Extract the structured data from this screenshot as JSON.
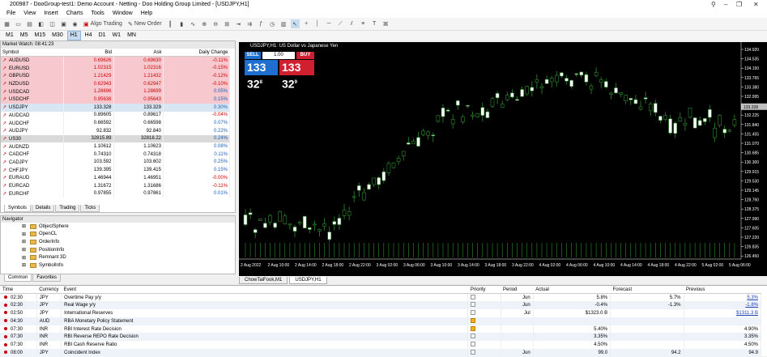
{
  "window": {
    "title": "200987 - DooGroup-test1: Demo Account - Netting - Doo Holding Group Limited - [USDJPY,H1]"
  },
  "menu": [
    "File",
    "View",
    "Insert",
    "Charts",
    "Tools",
    "Window",
    "Help"
  ],
  "toolbar": {
    "algo_label": "Algo Trading",
    "neworder_label": "New Order"
  },
  "timeframes": [
    "M1",
    "M5",
    "M15",
    "M30",
    "H1",
    "H4",
    "D1",
    "W1",
    "MN"
  ],
  "market_watch": {
    "title": "Market Watch: 08:41:23",
    "headers": [
      "Symbol",
      "Bid",
      "Ask",
      "Daily Change"
    ],
    "rows": [
      {
        "s": "AUDUSD",
        "b": "0.69626",
        "a": "0.69630",
        "c": "-0.11%",
        "t": "red"
      },
      {
        "s": "EURUSD",
        "b": "1.02315",
        "a": "1.02316",
        "c": "-0.15%",
        "t": "red"
      },
      {
        "s": "GBPUSD",
        "b": "1.21429",
        "a": "1.21432",
        "c": "-0.12%",
        "t": "red"
      },
      {
        "s": "NZDUSD",
        "b": "0.62943",
        "a": "0.62947",
        "c": "-0.10%",
        "t": "red"
      },
      {
        "s": "USDCAD",
        "b": "1.28696",
        "a": "1.28699",
        "c": "0.05%",
        "t": "red"
      },
      {
        "s": "USDCHF",
        "b": "0.95638",
        "a": "0.95643",
        "c": "0.15%",
        "t": "red"
      },
      {
        "s": "USDJPY",
        "b": "133.328",
        "a": "133.329",
        "c": "0.30%",
        "t": "sel"
      },
      {
        "s": "AUDCAD",
        "b": "0.89605",
        "a": "0.89617",
        "c": "-0.04%",
        "t": ""
      },
      {
        "s": "AUDCHF",
        "b": "0.66592",
        "a": "0.66598",
        "c": "0.07%",
        "t": ""
      },
      {
        "s": "AUDJPY",
        "b": "92.832",
        "a": "92.840",
        "c": "0.22%",
        "t": ""
      },
      {
        "s": "US30",
        "b": "32815.89",
        "a": "32818.22",
        "c": "0.24%",
        "t": "gray"
      },
      {
        "s": "AUDNZD",
        "b": "1.10612",
        "a": "1.10623",
        "c": "0.08%",
        "t": ""
      },
      {
        "s": "CADCHF",
        "b": "0.74310",
        "a": "0.74318",
        "c": "0.11%",
        "t": ""
      },
      {
        "s": "CADJPY",
        "b": "103.592",
        "a": "103.602",
        "c": "0.25%",
        "t": ""
      },
      {
        "s": "CHFJPY",
        "b": "139.395",
        "a": "139.415",
        "c": "0.15%",
        "t": ""
      },
      {
        "s": "EURAUD",
        "b": "1.46944",
        "a": "1.46951",
        "c": "-0.00%",
        "t": ""
      },
      {
        "s": "EURCAD",
        "b": "1.31672",
        "a": "1.31686",
        "c": "-0.11%",
        "t": ""
      },
      {
        "s": "EURCHF",
        "b": "0.97855",
        "a": "0.97861",
        "c": "0.01%",
        "t": ""
      }
    ],
    "tabs": [
      "Symbols",
      "Details",
      "Trading",
      "Ticks"
    ]
  },
  "navigator": {
    "title": "Navigator",
    "items": [
      "ObjectSphere",
      "OpenCL",
      "OrderInfo",
      "PositionInfo",
      "Remnant 3D",
      "SymbolInfo"
    ],
    "tabs": [
      "Common",
      "Favorites"
    ]
  },
  "chart": {
    "title": "USDJPY,H1:  US Dollar vs Japanese Yen",
    "sell_label": "SELL",
    "buy_label": "BUY",
    "lot": "1.00",
    "sell_big": "133 32",
    "sell_sup": "8",
    "buy_big": "133 32",
    "buy_sup": "9",
    "price_labels": [
      "134.920",
      "134.535",
      "134.150",
      "133.765",
      "133.380",
      "132.995",
      "132.610",
      "132.225",
      "131.840",
      "131.455",
      "131.070",
      "130.685",
      "130.300",
      "129.915",
      "129.530",
      "129.145",
      "128.760",
      "128.375",
      "127.990",
      "127.605",
      "127.220",
      "126.835",
      "126.450"
    ],
    "current_price": "133.328",
    "time_labels": [
      "2 Aug 2022",
      "2 Aug 10:00",
      "2 Aug 14:00",
      "2 Aug 18:00",
      "2 Aug 22:00",
      "3 Aug 02:00",
      "3 Aug 06:00",
      "3 Aug 10:00",
      "3 Aug 14:00",
      "3 Aug 18:00",
      "3 Aug 22:00",
      "4 Aug 02:00",
      "4 Aug 06:00",
      "4 Aug 10:00",
      "4 Aug 14:00",
      "4 Aug 18:00",
      "4 Aug 22:00",
      "5 Aug 02:00",
      "5 Aug 06:00"
    ],
    "tabs": [
      "ChowTaiFook,M1",
      "USDJPY,H1"
    ]
  },
  "calendar": {
    "headers": [
      "Time",
      "Currency",
      "Event",
      "Priority",
      "Period",
      "Actual",
      "Forecast",
      "Previous"
    ],
    "rows": [
      {
        "time": "02:30",
        "cur": "JPY",
        "ev": "Overtime Pay y/y",
        "period": "Jun",
        "actual": "5.8%",
        "fc": "5.7%",
        "prev": "5.3%",
        "pri": ""
      },
      {
        "time": "02:30",
        "cur": "JPY",
        "ev": "Real Wage y/y",
        "period": "Jun",
        "actual": "-0.4%",
        "fc": "-1.3%",
        "prev": "-1.8%",
        "pri": ""
      },
      {
        "time": "02:50",
        "cur": "JPY",
        "ev": "International Reserves",
        "period": "Jul",
        "actual": "$1323.0 B",
        "fc": "",
        "prev": "$1311.3 B",
        "pri": ""
      },
      {
        "time": "04:30",
        "cur": "AUD",
        "ev": "RBA Monetary Policy Statement",
        "period": "",
        "actual": "",
        "fc": "",
        "prev": "",
        "pri": "or"
      },
      {
        "time": "07:30",
        "cur": "INR",
        "ev": "RBI Interest Rate Decision",
        "period": "",
        "actual": "5.40%",
        "fc": "",
        "prev": "4.90%",
        "pri": "or"
      },
      {
        "time": "07:30",
        "cur": "INR",
        "ev": "RBI Reverse REPO Rate Decision",
        "period": "",
        "actual": "3.35%",
        "fc": "",
        "prev": "3.35%",
        "pri": ""
      },
      {
        "time": "07:30",
        "cur": "INR",
        "ev": "RBI Cash Reserve Ratio",
        "period": "",
        "actual": "4.50%",
        "fc": "",
        "prev": "4.50%",
        "pri": ""
      },
      {
        "time": "08:00",
        "cur": "JPY",
        "ev": "Coincident Index",
        "period": "Jun",
        "actual": "99.0",
        "fc": "94.2",
        "prev": "94.9",
        "pri": ""
      }
    ]
  }
}
